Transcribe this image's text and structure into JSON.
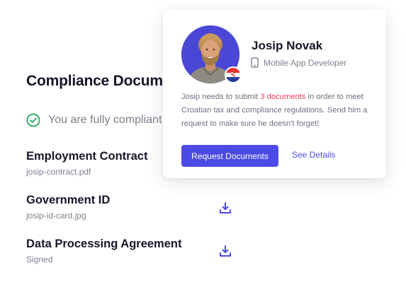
{
  "page": {
    "title": "Compliance Documents",
    "status_text": "You are fully compliant",
    "status_icon": "check-circle-icon",
    "status_color": "#1aa859",
    "accent_color": "#4b4ae6"
  },
  "documents": [
    {
      "title": "Employment Contract",
      "subtitle": "josip-contract.pdf",
      "downloadable": false
    },
    {
      "title": "Government ID",
      "subtitle": "josip-id-card.jpg",
      "downloadable": true,
      "icon": "download-icon"
    },
    {
      "title": "Data Processing Agreement",
      "subtitle": "Signed",
      "downloadable": true,
      "icon": "download-icon"
    }
  ],
  "profile_card": {
    "name": "Josip Novak",
    "role": "Mobile App Developer",
    "role_icon": "mobile-phone-icon",
    "flag": "croatia-flag-icon",
    "description_before": "Josip needs to submit ",
    "description_highlight": "3 documents",
    "description_after": " in order to meet Croatian tax and compliance regulations. Send him a request to make sure he doesn't forget!",
    "highlight_color": "#ef3b5b",
    "primary_button": "Request Documents",
    "secondary_link": "See Details"
  }
}
